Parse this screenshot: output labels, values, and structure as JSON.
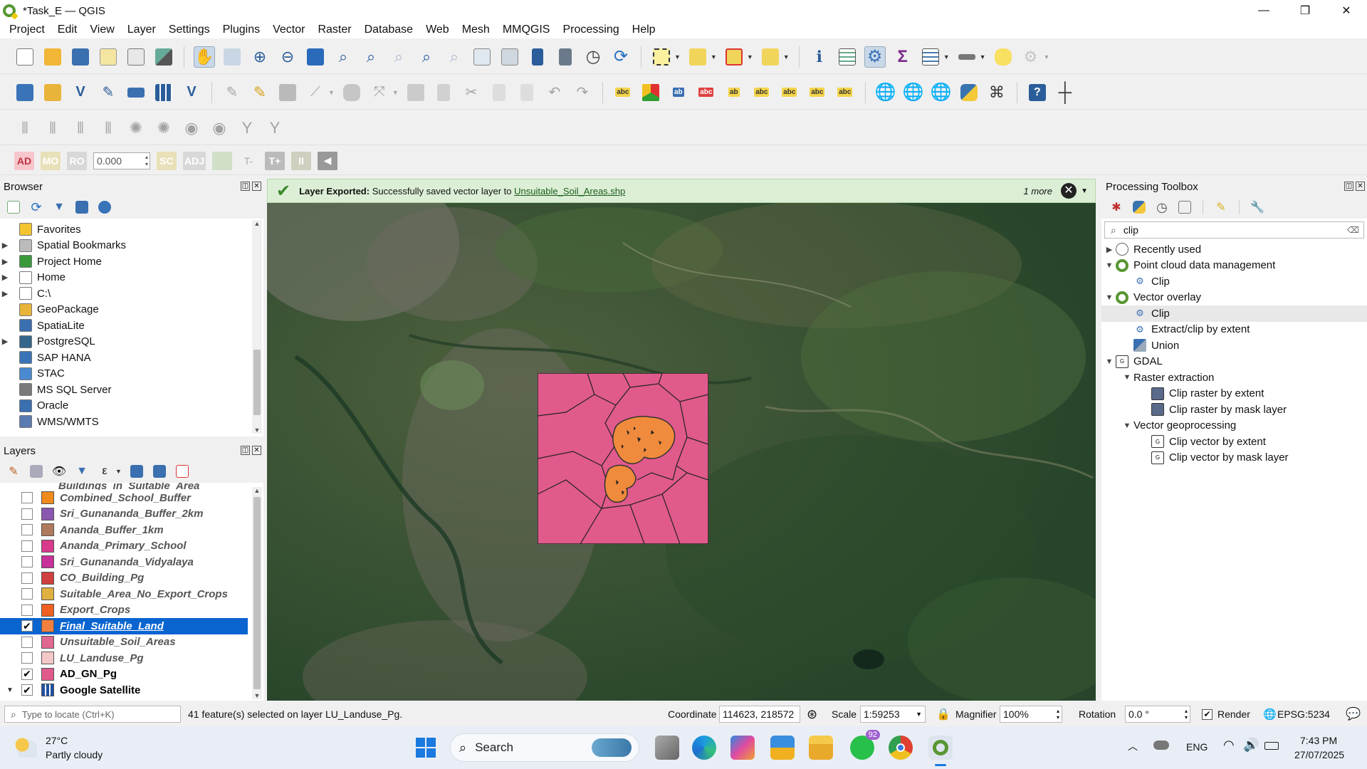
{
  "window": {
    "title": "*Task_E — QGIS",
    "min": "—",
    "max": "❐",
    "close": "✕"
  },
  "menu": [
    "Project",
    "Edit",
    "View",
    "Layer",
    "Settings",
    "Plugins",
    "Vector",
    "Raster",
    "Database",
    "Web",
    "Mesh",
    "MMQGIS",
    "Processing",
    "Help"
  ],
  "advanced_digitizing": {
    "ad": "AD",
    "mo": "MO",
    "ro": "RO",
    "value": "0.000",
    "sc": "SC",
    "adj": "ADJ",
    "t_minus": "T-",
    "t_plus": "T+"
  },
  "browser": {
    "title": "Browser",
    "items": [
      {
        "label": "Favorites",
        "icon": "star-icon",
        "arrow": ""
      },
      {
        "label": "Spatial Bookmarks",
        "icon": "bookmark-icon",
        "arrow": "▶"
      },
      {
        "label": "Project Home",
        "icon": "project-home-icon",
        "arrow": "▶"
      },
      {
        "label": "Home",
        "icon": "home-icon",
        "arrow": "▶"
      },
      {
        "label": "C:\\",
        "icon": "drive-icon",
        "arrow": "▶"
      },
      {
        "label": "GeoPackage",
        "icon": "geopackage-icon",
        "arrow": ""
      },
      {
        "label": "SpatiaLite",
        "icon": "spatialite-icon",
        "arrow": ""
      },
      {
        "label": "PostgreSQL",
        "icon": "postgresql-icon",
        "arrow": "▶"
      },
      {
        "label": "SAP HANA",
        "icon": "sap-hana-icon",
        "arrow": ""
      },
      {
        "label": "STAC",
        "icon": "stac-icon",
        "arrow": ""
      },
      {
        "label": "MS SQL Server",
        "icon": "mssql-icon",
        "arrow": ""
      },
      {
        "label": "Oracle",
        "icon": "oracle-icon",
        "arrow": ""
      },
      {
        "label": "WMS/WMTS",
        "icon": "wms-icon",
        "arrow": ""
      }
    ]
  },
  "layers": {
    "title": "Layers",
    "partial_top": "Buildings_in_Suitable_Area",
    "items": [
      {
        "label": "Combined_School_Buffer",
        "color": "#f08a1c",
        "checked": false
      },
      {
        "label": "Sri_Gunananda_Buffer_2km",
        "color": "#8a56b0",
        "checked": false
      },
      {
        "label": "Ananda_Buffer_1km",
        "color": "#b07a5c",
        "checked": false
      },
      {
        "label": "Ananda_Primary_School",
        "color": "#d83a8c",
        "checked": false
      },
      {
        "label": "Sri_Gunananda_Vidyalaya",
        "color": "#c8309a",
        "checked": false
      },
      {
        "label": "CO_Building_Pg",
        "color": "#d04040",
        "checked": false
      },
      {
        "label": "Suitable_Area_No_Export_Crops",
        "color": "#e0b040",
        "checked": false
      },
      {
        "label": "Export_Crops",
        "color": "#f06020",
        "checked": false
      },
      {
        "label": "Final_Suitable_Land",
        "color": "#f08040",
        "checked": true,
        "selected": true
      },
      {
        "label": "Unsuitable_Soil_Areas",
        "color": "#e06890",
        "checked": false
      },
      {
        "label": "LU_Landuse_Pg",
        "color": "#f4c8c8",
        "checked": false
      },
      {
        "label": "AD_GN_Pg",
        "color": "#e05a8c",
        "checked": true
      },
      {
        "label": "Google Satellite",
        "color": "#2050a0",
        "checked": true
      }
    ]
  },
  "message": {
    "bold": "Layer Exported:",
    "text": "Successfully saved vector layer to",
    "link": "Unsuitable_Soil_Areas.shp",
    "more": "1 more"
  },
  "toolbox": {
    "title": "Processing Toolbox",
    "search": "clip",
    "items": [
      {
        "label": "Recently used",
        "indent": 0,
        "arrow": "▶",
        "icon": "clock-icon"
      },
      {
        "label": "Point cloud data management",
        "indent": 0,
        "arrow": "▼",
        "icon": "qgis-icon"
      },
      {
        "label": "Clip",
        "indent": 1,
        "arrow": "",
        "icon": "gear-icon"
      },
      {
        "label": "Vector overlay",
        "indent": 0,
        "arrow": "▼",
        "icon": "qgis-icon"
      },
      {
        "label": "Clip",
        "indent": 1,
        "arrow": "",
        "icon": "gear-icon",
        "hover": true
      },
      {
        "label": "Extract/clip by extent",
        "indent": 1,
        "arrow": "",
        "icon": "gear-icon"
      },
      {
        "label": "Union",
        "indent": 1,
        "arrow": "",
        "icon": "union-icon"
      },
      {
        "label": "GDAL",
        "indent": 0,
        "arrow": "▼",
        "icon": "gdal-icon"
      },
      {
        "label": "Raster extraction",
        "indent": 1,
        "arrow": "▼",
        "icon": ""
      },
      {
        "label": "Clip raster by extent",
        "indent": 2,
        "arrow": "",
        "icon": "raster-icon"
      },
      {
        "label": "Clip raster by mask layer",
        "indent": 2,
        "arrow": "",
        "icon": "raster-icon"
      },
      {
        "label": "Vector geoprocessing",
        "indent": 1,
        "arrow": "▼",
        "icon": ""
      },
      {
        "label": "Clip vector by extent",
        "indent": 2,
        "arrow": "",
        "icon": "gdal-icon"
      },
      {
        "label": "Clip vector by mask layer",
        "indent": 2,
        "arrow": "",
        "icon": "gdal-icon"
      }
    ]
  },
  "status": {
    "locate_placeholder": "Type to locate (Ctrl+K)",
    "selection": "41 feature(s) selected on layer LU_Landuse_Pg.",
    "coordinate_label": "Coordinate",
    "coordinate": "114623, 218572",
    "scale_label": "Scale",
    "scale": "1:59253",
    "magnifier_label": "Magnifier",
    "magnifier": "100%",
    "rotation_label": "Rotation",
    "rotation": "0.0 °",
    "render_label": "Render",
    "crs": "EPSG:5234"
  },
  "taskbar": {
    "temp": "27°C",
    "weather": "Partly cloudy",
    "search": "Search",
    "whatsapp_badge": "92",
    "lang": "ENG",
    "time": "7:43 PM",
    "date": "27/07/2025"
  },
  "colors": {
    "accent": "#0a64d0",
    "polygon": "#e05a8c",
    "suitable": "#f08a3c",
    "msg_bg": "#dcefd6"
  }
}
